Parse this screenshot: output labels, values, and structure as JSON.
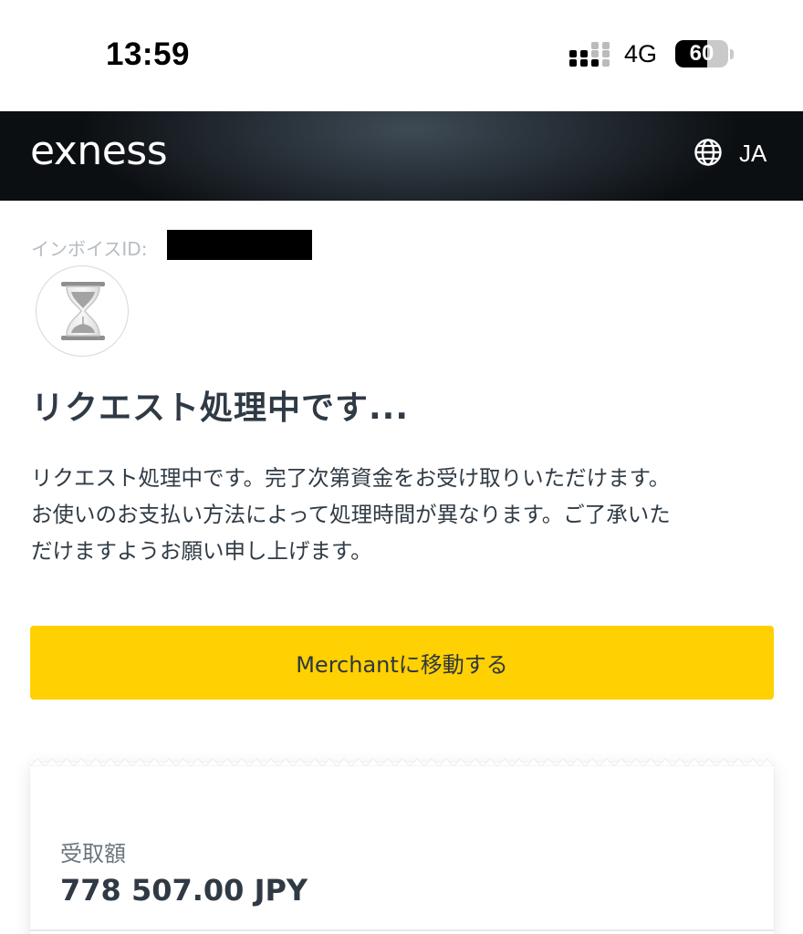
{
  "status_bar": {
    "time": "13:59",
    "network": "4G",
    "battery_level": "60",
    "battery_fraction": 0.6
  },
  "header": {
    "logo_text": "exness",
    "language": "JA",
    "language_icon": "globe-icon"
  },
  "invoice": {
    "label": "インボイスID:",
    "status_icon": "hourglass-icon"
  },
  "main": {
    "title": "リクエスト処理中です...",
    "description_lines": [
      "リクエスト処理中です。完了次第資金をお受け取りいただけます。",
      "お使いのお支払い方法によって処理時間が異なります。ご了承いた",
      "だけますようお願い申し上げます。"
    ],
    "button_label": "Merchantに移動する",
    "button_color": "#ffd002"
  },
  "receipt": {
    "amount_label": "受取額",
    "amount_value": "778 507.00 JPY"
  }
}
